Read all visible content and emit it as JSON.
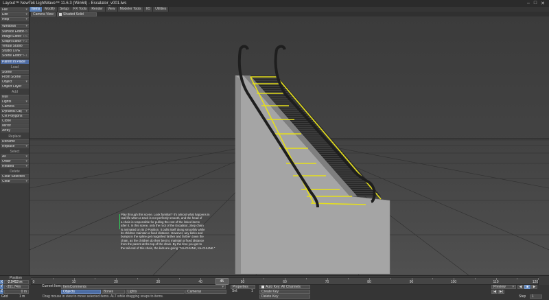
{
  "window": {
    "title": "Layout™ NewTek LightWave™ 11.6.3 (Win64) - Escalator_v001.lws",
    "controls": [
      "–",
      "□",
      "✕"
    ]
  },
  "left_panel": {
    "top_items": [
      {
        "label": "File",
        "arrow": "▾"
      },
      {
        "label": "Edit",
        "arrow": "▾"
      },
      {
        "label": "Help",
        "arrow": "▾"
      }
    ],
    "windows": {
      "label": "Windows",
      "arrow": "▾"
    },
    "editors": [
      {
        "label": "Surface Editor",
        "key": "F5"
      },
      {
        "label": "Image Editor",
        "key": "F6"
      },
      {
        "label": "Graph Editor",
        "key": "^F2"
      },
      {
        "label": "Virtual Studio",
        "key": ""
      },
      {
        "label": "Studio LIVE",
        "key": ""
      },
      {
        "label": "Scene Editor",
        "key": "^F1"
      }
    ],
    "parent_in_place": "Parent in Place",
    "load_header": "Load",
    "load_items": [
      {
        "label": "Scene",
        "arrow": ""
      },
      {
        "label": "From Scene",
        "arrow": ""
      },
      {
        "label": "Object",
        "arrow": "▾"
      },
      {
        "label": "Object Layer",
        "arrow": ""
      }
    ],
    "add_header": "Add",
    "add_items": [
      {
        "label": "Null",
        "arrow": ""
      },
      {
        "label": "Lights",
        "arrow": "▾"
      },
      {
        "label": "Camera",
        "arrow": ""
      },
      {
        "label": "Dynamic Obj",
        "arrow": "▾"
      },
      {
        "label": "Cvt Polygons",
        "arrow": ""
      },
      {
        "label": "Clone",
        "arrow": ""
      },
      {
        "label": "Mirror",
        "arrow": ""
      },
      {
        "label": "Array",
        "arrow": ""
      }
    ],
    "replace_header": "Replace",
    "replace_items": [
      {
        "label": "Rename",
        "arrow": ""
      },
      {
        "label": "Replace",
        "arrow": "▾"
      }
    ],
    "select_header": "Select",
    "select_items": [
      {
        "label": "All",
        "arrow": "▾"
      },
      {
        "label": "Order",
        "arrow": "▾"
      },
      {
        "label": "Related",
        "arrow": "▾"
      }
    ],
    "delete_header": "Delete",
    "delete_items": [
      {
        "label": "Clear Selected",
        "arrow": ""
      },
      {
        "label": "Clear",
        "arrow": "▾"
      }
    ]
  },
  "tabs": [
    "Items",
    "Modify",
    "Setup",
    "FX Tools",
    "Render",
    "View",
    "Modeler Tools",
    "I/O",
    "Utilities"
  ],
  "active_tab": "Items",
  "viewport_header": {
    "view_mode": "Camera View",
    "shading_mode": "Shaded Solid"
  },
  "help_text": [
    "Play through this scene. Look familiar? It's almost what happens in",
    "real life when a track is not perfectly smooth, and the head of",
    "a chain is responsible for pulling the rest of the linked items",
    "after it. In this scene, only the root of the Escalator_Step chain",
    "is animated on its Z-Position. It pulls itself along smoothly while",
    "its children maintain a fixed distance. However, any kinks and",
    "bumps in the spline get magnified farther and farther down the",
    "chain, as the children do their best to maintain a fixed distance",
    "from the parent at the top of the chain. By the time you get to",
    "the tail end of this chain, the kids are going: \"Ka-CHUNK, Ka-CHUNK.\""
  ],
  "timeline": {
    "position_label": "Position",
    "position_value": "-2.0453 m",
    "axis": "X",
    "tick_labels": [
      "0",
      "10",
      "20",
      "30",
      "40",
      "50",
      "60",
      "70",
      "80",
      "90",
      "100",
      "110",
      "120"
    ],
    "current_frame": "45",
    "end_frame": "120",
    "range_min": 0,
    "range_max": 120
  },
  "bottom": {
    "y_axis": "Y",
    "y_value": "-351.74m",
    "z_axis": "Z",
    "z_value": "0 m",
    "grid_label": "Grid",
    "grid_value": "1 m",
    "current_item_label": "Current Item",
    "current_item": "ItemComments",
    "objects_btn": "Objects",
    "bones_btn": "Bones",
    "lights_btn": "Lights",
    "cameras_btn": "Cameras",
    "properties_btn": "Properties",
    "sel_label": "Sel:",
    "sel_value": "1",
    "auto_key": "Auto Key: All Channels",
    "create_key": "Create Key",
    "delete_key": "Delete Key",
    "status": "Drag mouse in view to move selected items. ALT while dragging snaps to items.",
    "preview": "Preview",
    "step_label": "Step",
    "step_value": "1",
    "play_controls": [
      "|◀",
      "◀",
      "■",
      "▶",
      "▶|"
    ]
  },
  "colors": {
    "accent": "#5a7fb5",
    "selection_yellow": "#e6e01a"
  }
}
